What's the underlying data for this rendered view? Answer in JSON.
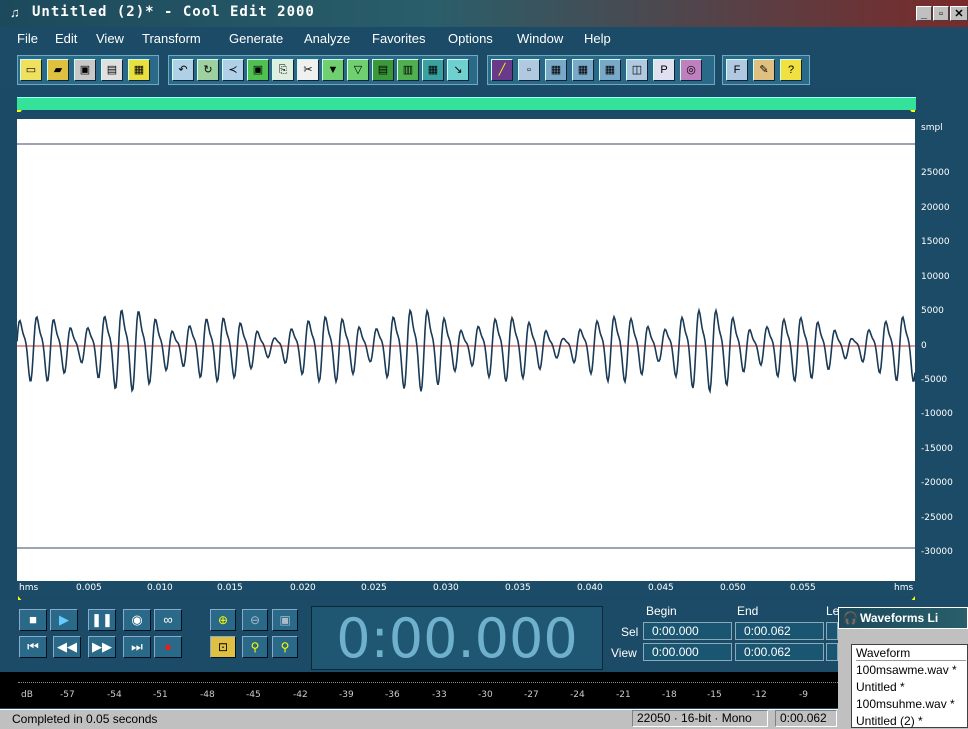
{
  "window": {
    "title": "Untitled (2)* - Cool Edit 2000",
    "controls": [
      "_",
      "▫",
      "✕"
    ]
  },
  "menu": [
    {
      "label": "File"
    },
    {
      "label": "Edit"
    },
    {
      "label": "View"
    },
    {
      "label": "Transform"
    },
    {
      "label": "Generate"
    },
    {
      "label": "Analyze"
    },
    {
      "label": "Favorites"
    },
    {
      "label": "Options"
    },
    {
      "label": "Window"
    },
    {
      "label": "Help"
    }
  ],
  "toolbar": {
    "groups": [
      [
        "new-icon",
        "open-icon",
        "save-icon",
        "save-as-icon",
        "close-icon"
      ],
      [
        "undo-icon",
        "repeat-icon",
        "trim-icon",
        "select-all-icon",
        "copy-to-new-icon",
        "cut-icon",
        "paste-icon",
        "mix-paste-icon",
        "paste-new-icon",
        "amplify-icon",
        "crop-icon",
        "goto-icon"
      ],
      [
        "spectral-icon",
        "waveform-view-icon",
        "grid-icon",
        "grid2-icon",
        "grid3-icon",
        "settings-icon",
        "properties-icon",
        "cd-icon"
      ],
      [
        "favorites-icon",
        "scripts-icon",
        "help-icon"
      ]
    ]
  },
  "waveform": {
    "y_axis": {
      "unit": "smpl",
      "ticks": [
        "25000",
        "20000",
        "15000",
        "10000",
        "5000",
        "0",
        "-5000",
        "-10000",
        "-15000",
        "-20000",
        "-25000",
        "-30000"
      ]
    },
    "time_axis": {
      "unit_left": "hms",
      "unit_right": "hms",
      "ticks": [
        "0.005",
        "0.010",
        "0.015",
        "0.020",
        "0.025",
        "0.030",
        "0.035",
        "0.040",
        "0.045",
        "0.050",
        "0.055"
      ]
    },
    "colors": {
      "background": "#ffffff",
      "wave": "#1b3a55",
      "center_line": "#c03030",
      "limit_lines": "#3a4a6a"
    }
  },
  "transport": {
    "time_display": "0:00.000",
    "selection": {
      "headers": {
        "begin": "Begin",
        "end": "End",
        "length": "Le"
      },
      "sel_label": "Sel",
      "view_label": "View",
      "sel_begin": "0:00.000",
      "sel_end": "0:00.062",
      "view_begin": "0:00.000",
      "view_end": "0:00.062"
    }
  },
  "meter": {
    "ticks": [
      "dB",
      "-57",
      "-54",
      "-51",
      "-48",
      "-45",
      "-42",
      "-39",
      "-36",
      "-33",
      "-30",
      "-27",
      "-24",
      "-21",
      "-18",
      "-15",
      "-12",
      "-9"
    ]
  },
  "status": {
    "message": "Completed in 0.05 seconds",
    "format": "22050 · 16-bit · Mono",
    "length": "0:00.062"
  },
  "waveforms_list": {
    "title": "Waveforms Li",
    "header": "Waveform",
    "items": [
      "100msawme.wav *",
      "Untitled *",
      "100msuhme.wav *",
      "Untitled (2) *"
    ]
  }
}
